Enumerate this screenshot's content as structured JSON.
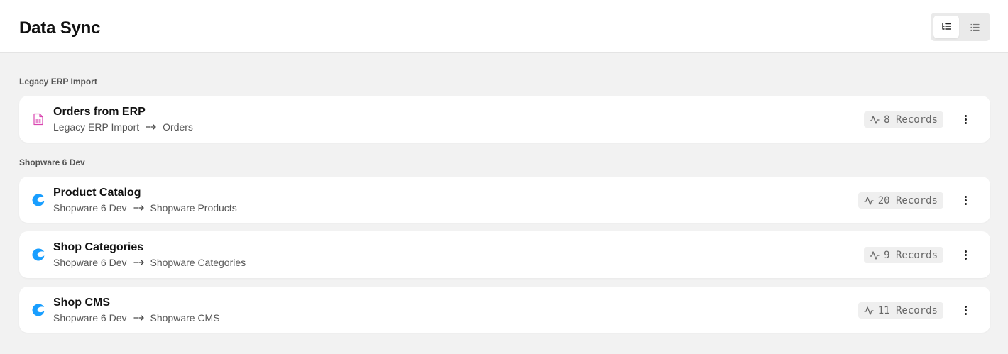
{
  "header": {
    "title": "Data Sync",
    "view_toggle": [
      {
        "icon": "tree-list-icon",
        "active": true
      },
      {
        "icon": "list-icon",
        "active": false
      }
    ]
  },
  "groups": [
    {
      "label": "Legacy ERP Import",
      "items": [
        {
          "title": "Orders from ERP",
          "source": "Legacy ERP Import",
          "target": "Orders",
          "records": "8 Records",
          "icon": "file-spreadsheet-icon"
        }
      ]
    },
    {
      "label": "Shopware 6 Dev",
      "items": [
        {
          "title": "Product Catalog",
          "source": "Shopware 6 Dev",
          "target": "Shopware Products",
          "records": "20 Records",
          "icon": "shopware-logo-icon"
        },
        {
          "title": "Shop Categories",
          "source": "Shopware 6 Dev",
          "target": "Shopware Categories",
          "records": "9 Records",
          "icon": "shopware-logo-icon"
        },
        {
          "title": "Shop CMS",
          "source": "Shopware 6 Dev",
          "target": "Shopware CMS",
          "records": "11 Records",
          "icon": "shopware-logo-icon"
        }
      ]
    }
  ],
  "colors": {
    "shopware": "#189eff",
    "file_icon": "#d946b0",
    "page_bg": "#f2f2f2"
  }
}
